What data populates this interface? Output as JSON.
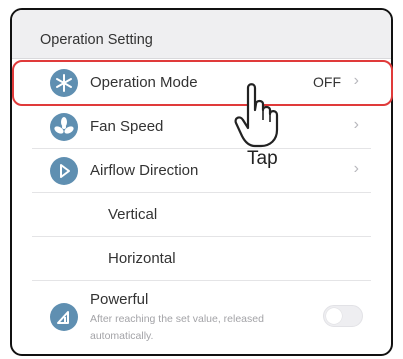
{
  "section": {
    "title": "Operation Setting"
  },
  "rows": {
    "operation_mode": {
      "label": "Operation Mode",
      "value": "OFF",
      "chevron": "›",
      "icon": "snowflake-sun-icon"
    },
    "fan_speed": {
      "label": "Fan Speed",
      "chevron": "›",
      "icon": "fan-icon"
    },
    "airflow_direction": {
      "label": "Airflow Direction",
      "chevron": "›",
      "icon": "airflow-icon"
    },
    "vertical": {
      "label": "Vertical"
    },
    "horizontal": {
      "label": "Horizontal"
    },
    "powerful": {
      "label": "Powerful",
      "description": "After reaching the set value, released automatically.",
      "icon": "powerful-icon",
      "toggle_on": false
    }
  },
  "annotation": {
    "tap_label": "Tap"
  },
  "colors": {
    "accent_icon": "#5f8fb1",
    "highlight": "#e03a3a",
    "header_bg": "#efeff1"
  }
}
